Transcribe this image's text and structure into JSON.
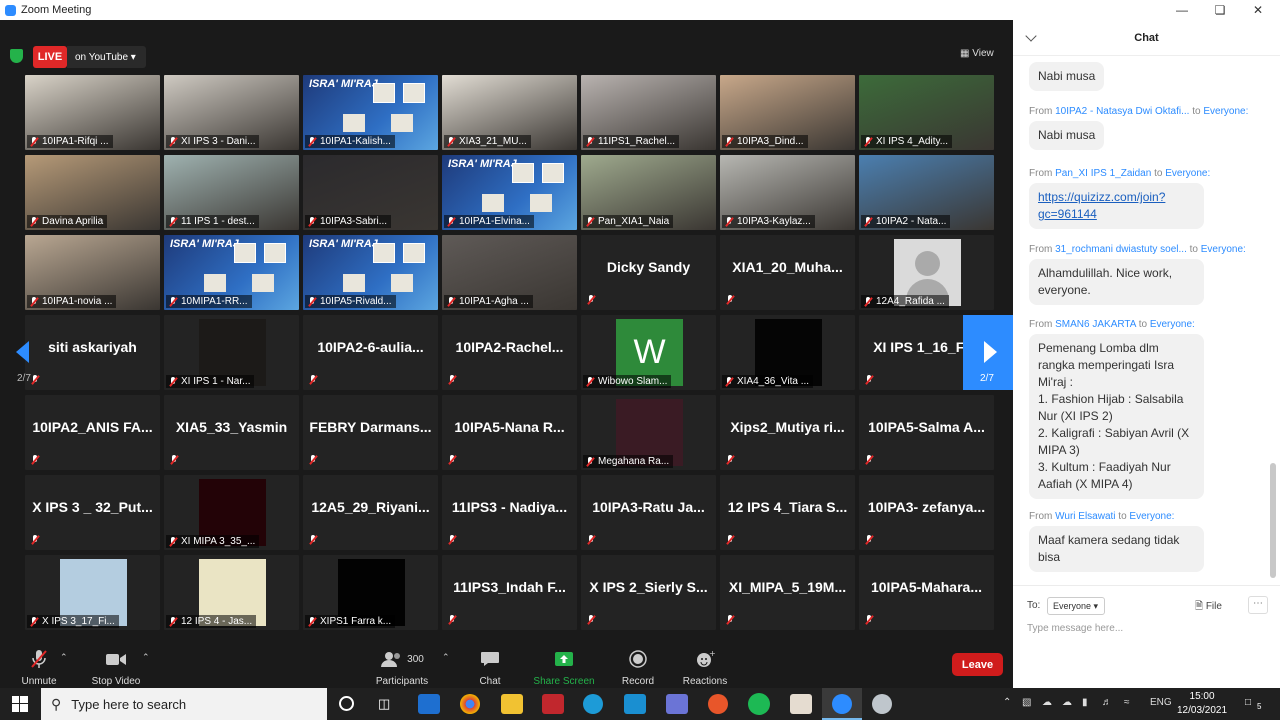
{
  "window": {
    "title": "Zoom Meeting"
  },
  "meeting": {
    "live_label": "LIVE",
    "stream_label": "on YouTube",
    "view_label": "View",
    "page_left": "2/7",
    "page_right": "2/7"
  },
  "tiles": [
    {
      "name": "10IPA1-Rifqi ...",
      "kind": "video",
      "bg": "#d9d3c8"
    },
    {
      "name": "XI IPS 3 - Dani...",
      "kind": "video",
      "bg": "#cfcac2"
    },
    {
      "name": "10IPA1-Kalish...",
      "kind": "isra"
    },
    {
      "name": "XIA3_21_MU...",
      "kind": "video",
      "bg": "#e2ddd4"
    },
    {
      "name": "11IPS1_Rachel...",
      "kind": "video",
      "bg": "#b9b3b0"
    },
    {
      "name": "10IPA3_Dind...",
      "kind": "video",
      "bg": "#c8a88a"
    },
    {
      "name": "XI IPS 4_Adity...",
      "kind": "video",
      "bg": "#3c6b3a"
    },
    {
      "name": "Davina Aprilia",
      "kind": "video",
      "bg": "#b69a78"
    },
    {
      "name": "11 IPS 1 - dest...",
      "kind": "video",
      "bg": "#9fb2b0"
    },
    {
      "name": "10IPA3-Sabri...",
      "kind": "video",
      "bg": "#2b2a2d"
    },
    {
      "name": "10IPA1-Elvina...",
      "kind": "isra"
    },
    {
      "name": "Pan_XIA1_Naia",
      "kind": "video",
      "bg": "#9faa8e"
    },
    {
      "name": "10IPA3-Kaylaz...",
      "kind": "video",
      "bg": "#b7b7b2"
    },
    {
      "name": "10IPA2 - Nata...",
      "kind": "video",
      "bg": "#4b7fb0"
    },
    {
      "name": "10IPA1-novia ...",
      "kind": "video",
      "bg": "#b9a792"
    },
    {
      "name": "10MIPA1-RR...",
      "kind": "isra"
    },
    {
      "name": "10IPA5-Rivald...",
      "kind": "isra"
    },
    {
      "name": "10IPA1-Agha ...",
      "kind": "video",
      "bg": "#5f5a57"
    },
    {
      "name": "Dicky Sandy",
      "kind": "name"
    },
    {
      "name": "XIA1_20_Muha...",
      "kind": "name"
    },
    {
      "name": "12A4_Rafida ...",
      "kind": "avatar"
    },
    {
      "name": "siti askariyah",
      "kind": "name"
    },
    {
      "name": "XI IPS 1 - Nar...",
      "kind": "smallvid",
      "bg": "#1c1a18"
    },
    {
      "name": "10IPA2-6-aulia...",
      "kind": "name"
    },
    {
      "name": "10IPA2-Rachel...",
      "kind": "name"
    },
    {
      "name": "Wibowo Slam...",
      "kind": "w",
      "letter": "W"
    },
    {
      "name": "XIA4_36_Vita ...",
      "kind": "smallvid",
      "bg": "#050505"
    },
    {
      "name": "XI IPS 1_16_Fi...",
      "kind": "name"
    },
    {
      "name": "10IPA2_ANIS FA...",
      "kind": "name"
    },
    {
      "name": "XIA5_33_Yasmin",
      "kind": "name"
    },
    {
      "name": "FEBRY Darmans...",
      "kind": "name"
    },
    {
      "name": "10IPA5-Nana R...",
      "kind": "name"
    },
    {
      "name": "Megahana Ra...",
      "kind": "smallvid",
      "bg": "#3a1b24"
    },
    {
      "name": "Xips2_Mutiya ri...",
      "kind": "name"
    },
    {
      "name": "10IPA5-Salma A...",
      "kind": "name"
    },
    {
      "name": "X IPS 3 _ 32_Put...",
      "kind": "name"
    },
    {
      "name": "XI MIPA 3_35_...",
      "kind": "smallvid",
      "bg": "#230307"
    },
    {
      "name": "12A5_29_Riyani...",
      "kind": "name"
    },
    {
      "name": "11IPS3 - Nadiya...",
      "kind": "name"
    },
    {
      "name": "10IPA3-Ratu Ja...",
      "kind": "name"
    },
    {
      "name": "12 IPS 4_Tiara S...",
      "kind": "name"
    },
    {
      "name": "10IPA3- zefanya...",
      "kind": "name"
    },
    {
      "name": "X IPS 3_17_Fi...",
      "kind": "smallvid",
      "bg": "#b4cde0"
    },
    {
      "name": "12 IPS 4 - Jas...",
      "kind": "smallvid",
      "bg": "#eae4c4"
    },
    {
      "name": "XIPS1 Farra k...",
      "kind": "smallvid",
      "bg": "#020202"
    },
    {
      "name": "11IPS3_Indah F...",
      "kind": "name"
    },
    {
      "name": "X IPS 2_Sierly S...",
      "kind": "name"
    },
    {
      "name": "XI_MIPA_5_19M...",
      "kind": "name"
    },
    {
      "name": "10IPA5-Mahara...",
      "kind": "name"
    }
  ],
  "isra_title": "ISRA' MI'RAJ",
  "toolbar": {
    "unmute": "Unmute",
    "stop_video": "Stop Video",
    "participants": "Participants",
    "participants_count": "300",
    "chat": "Chat",
    "share": "Share Screen",
    "record": "Record",
    "reactions": "Reactions",
    "leave": "Leave"
  },
  "chat": {
    "title": "Chat",
    "messages": [
      {
        "from": "",
        "to": "",
        "text": "Nabi musa",
        "link": false
      },
      {
        "from": "10IPA2 - Natasya Dwi Oktafi...",
        "to": "Everyone:",
        "text": "Nabi musa",
        "link": false
      },
      {
        "from": "Pan_XI IPS 1_Zaidan",
        "to": "Everyone:",
        "text": "https://quizizz.com/join?gc=961144",
        "link": true
      },
      {
        "from": "31_rochmani dwiastuty soel...",
        "to": "Everyone:",
        "text": "Alhamdulillah. Nice work, everyone.",
        "link": false
      },
      {
        "from": "SMAN6 JAKARTA",
        "to": "Everyone:",
        "text": "Pemenang Lomba dlm rangka memperingati Isra Mi'raj :\n1. Fashion Hijab : Salsabila Nur (XI IPS 2)\n2. Kaligrafi : Sabiyan Avril (X MIPA 3)\n3. Kultum : Faadiyah Nur Aafiah (X MIPA 4)",
        "link": false
      },
      {
        "from": "Wuri Elsawati",
        "to": "Everyone:",
        "text": "Maaf kamera sedang tidak bisa",
        "link": false
      }
    ],
    "from_word": "From",
    "to_word": "to",
    "to_label": "To:",
    "to_value": "Everyone",
    "file_label": "File",
    "placeholder": "Type message here..."
  },
  "taskbar": {
    "search_placeholder": "Type here to search",
    "time": "15:00",
    "date": "12/03/2021",
    "lang": "ENG",
    "notif_count": "5"
  },
  "colors": {
    "accent": "#2d8cff",
    "live": "#e02828",
    "leave": "#d01c1c",
    "share": "#24b24a"
  }
}
